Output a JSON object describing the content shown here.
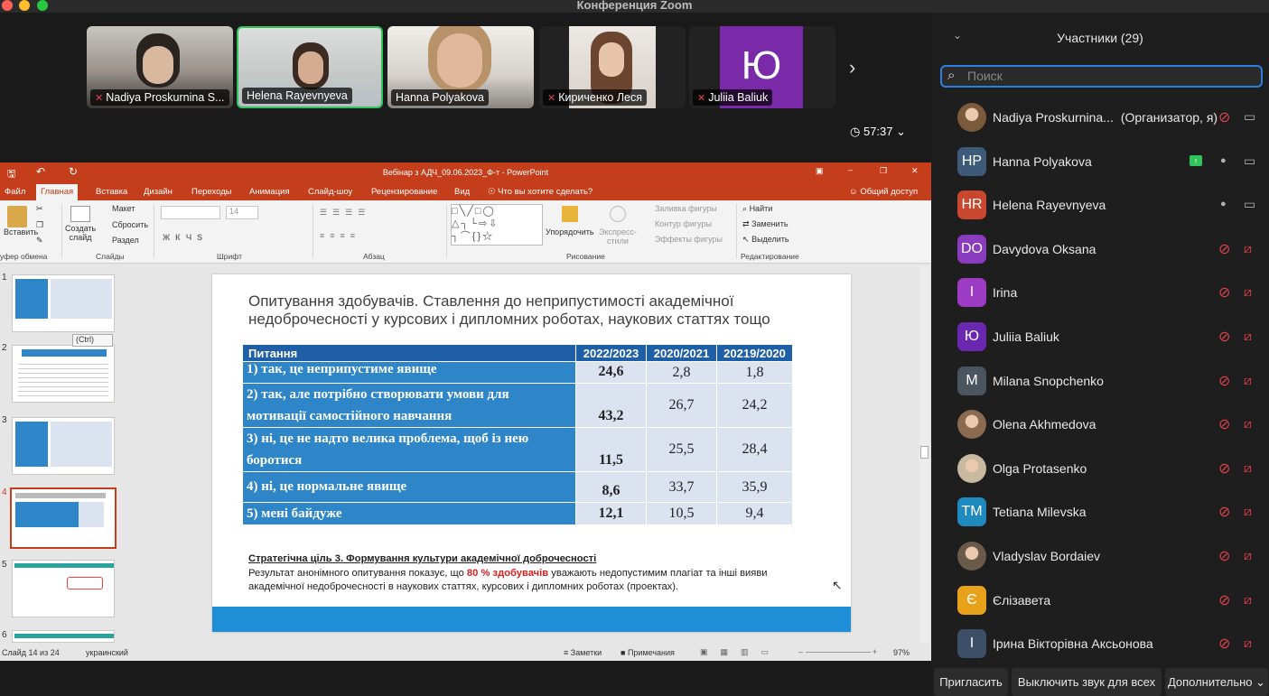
{
  "window": {
    "title": "Конференция Zoom"
  },
  "videos": [
    {
      "name": "Nadiya Proskurnina S...",
      "muted": true
    },
    {
      "name": "Helena Rayevnyeva",
      "muted": false
    },
    {
      "name": "Hanna Polyakova",
      "muted": false
    },
    {
      "name": "Кириченко Леся",
      "muted": true
    },
    {
      "name": "Juliia Baliuk",
      "muted": true,
      "initial": "Ю"
    }
  ],
  "timer": "57:37",
  "ppt": {
    "title": "Вебінар з АДЧ_09.06.2023_Ф-т - PowerPoint",
    "tabs": [
      "Файл",
      "Главная",
      "Вставка",
      "Дизайн",
      "Переходы",
      "Анимация",
      "Слайд-шоу",
      "Рецензирование",
      "Вид"
    ],
    "tell": "Что вы хотите сделать?",
    "share": "Общий доступ",
    "ribbon": {
      "paste": "Вставить",
      "clipboard": "уфер обмена",
      "create": "Создать",
      "slide": "слайд",
      "layout": "Макет",
      "reset": "Сбросить",
      "section": "Раздел",
      "slides_group": "Слайды",
      "font_group": "Шрифт",
      "font_size": "14",
      "para_group": "Абзац",
      "arrange": "Упорядочить",
      "express": "Экспресс-",
      "styles": "стили",
      "fill": "Заливка фигуры",
      "outline": "Контур фигуры",
      "effects": "Эффекты фигуры",
      "draw_group": "Рисование",
      "find": "Найти",
      "replace": "Заменить",
      "select": "Выделить",
      "edit_group": "Редактирование"
    },
    "paste_tag": "(Ctrl)",
    "slide_numbers": [
      "1",
      "2",
      "3",
      "4",
      "5",
      "6"
    ],
    "status": {
      "slide": "Слайд 14 из 24",
      "lang": "украинский",
      "notes": "Заметки",
      "comments": "Примечания",
      "zoom": "97%"
    }
  },
  "slide": {
    "title": "Опитування здобувачів. Ставлення до неприпустимості академічної недоброчесності у курсових і дипломних роботах, наукових статтях тощо",
    "table": {
      "headers": [
        "Питання",
        "2022/2023",
        "2020/2021",
        "20219/2020"
      ],
      "rows": [
        {
          "q": "1) так, це неприпустиме явище",
          "a": "24,6",
          "b": "2,8",
          "c": "1,8"
        },
        {
          "q": "2) так, але потрібно створювати умови для мотивації самостійного навчання",
          "a": "43,2",
          "b": "26,7",
          "c": "24,2"
        },
        {
          "q": "3) ні, це не надто велика проблема, щоб із нею боротися",
          "a": "11,5",
          "b": "25,5",
          "c": "28,4"
        },
        {
          "q": "4) ні, це нормальне явище",
          "a": "8,6",
          "b": "33,7",
          "c": "35,9"
        },
        {
          "q": "5) мені байдуже",
          "a": "12,1",
          "b": "10,5",
          "c": "9,4"
        }
      ]
    },
    "goal": "Стратегічна ціль 3. Формування культури академічної доброчесності",
    "result_pre": "Результат анонімного опитування показує, що ",
    "result_hl": "80 % здобувачів",
    "result_post": " уважають недопустимим плагіат та інші вияви академічної недоброчесності в наукових статтях, курсових і дипломних роботах (проектах)."
  },
  "participants": {
    "header": "Участники (29)",
    "search_placeholder": "Поиск",
    "list": [
      {
        "name": "Nadiya Proskurnina...",
        "role": "(Организатор, я)",
        "initials": "",
        "color": "#7a5a3a",
        "mic": "muted",
        "cam": "on"
      },
      {
        "name": "Hanna Polyakova",
        "initials": "HP",
        "color": "#3d5a78",
        "mic": "on",
        "cam": "on",
        "sharing": true
      },
      {
        "name": "Helena Rayevnyeva",
        "initials": "HR",
        "color": "#c8472e",
        "mic": "on",
        "cam": "on"
      },
      {
        "name": "Davydova Oksana",
        "initials": "DO",
        "color": "#8a3cbf",
        "mic": "muted",
        "cam": "off"
      },
      {
        "name": "Irina",
        "initials": "I",
        "color": "#9b3cc2",
        "mic": "muted",
        "cam": "off"
      },
      {
        "name": "Juliia Baliuk",
        "initials": "Ю",
        "color": "#6a28b0",
        "mic": "muted",
        "cam": "off"
      },
      {
        "name": "Milana Snopchenko",
        "initials": "M",
        "color": "#4a5560",
        "mic": "muted",
        "cam": "off"
      },
      {
        "name": "Olena Akhmedova",
        "initials": "",
        "color": "#8a6a50",
        "mic": "muted",
        "cam": "off"
      },
      {
        "name": "Olga Protasenko",
        "initials": "",
        "color": "#c9b9a0",
        "mic": "muted",
        "cam": "off"
      },
      {
        "name": "Tetiana Milevska",
        "initials": "TM",
        "color": "#1f8ac0",
        "mic": "muted",
        "cam": "off"
      },
      {
        "name": "Vladyslav Bordaiev",
        "initials": "",
        "color": "#6a5a4a",
        "mic": "muted",
        "cam": "off"
      },
      {
        "name": "Єлізавета",
        "initials": "Є",
        "color": "#e8a21a",
        "mic": "muted",
        "cam": "off"
      },
      {
        "name": "Ірина Вікторівна Аксьонова",
        "initials": "І",
        "color": "#3d4f68",
        "mic": "muted",
        "cam": "off"
      }
    ],
    "buttons": {
      "invite": "Пригласить",
      "mute_all": "Выключить звук для всех",
      "more": "Дополнительно"
    }
  }
}
